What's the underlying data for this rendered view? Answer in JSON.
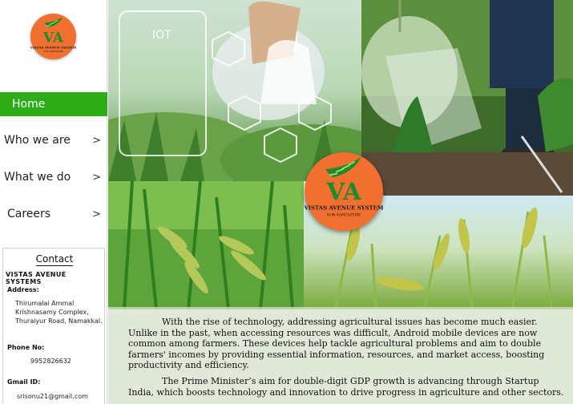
{
  "brand": {
    "logo_monogram": "VA",
    "logo_name": "VISTAS AVENUE SYSTEM",
    "logo_tagline": "AI IN AGRICULTURE"
  },
  "nav": {
    "items": [
      {
        "label": "Home",
        "active": true
      },
      {
        "label": "Who we are",
        "chevron": ">"
      },
      {
        "label": "What we do",
        "chevron": ">"
      },
      {
        "label": "Careers",
        "chevron": ">"
      }
    ]
  },
  "contact": {
    "title": "Contact",
    "company": "VISTAS AVENUE SYSTEMS",
    "address_label": "Address:",
    "address": "Thirumalai Ammal Krishnasamy Complex, Thuraiyur Road, Namakkal.",
    "phone_label": "Phone No:",
    "phone": "9952826632",
    "email_label": "Gmail ID:",
    "email": "srisonu21@gmail.com"
  },
  "hero": {
    "iot_label": "IOT"
  },
  "content": {
    "paragraph1": "With the rise of technology, addressing agricultural issues has become much easier. Unlike in the past, when accessing resources was difficult, Android mobile devices are now common among farmers. These devices help tackle agricultural problems and aim to double farmers' incomes by providing essential information, resources, and market access, boosting productivity and efficiency.",
    "paragraph2": "The Prime Minister’s aim for double-digit GDP growth is advancing through Startup India, which boosts technology and innovation to drive progress in agriculture and other sectors."
  },
  "colors": {
    "active_nav": "#2dac17",
    "logo_orange": "#f1702f",
    "logo_green": "#1e8a2a"
  }
}
